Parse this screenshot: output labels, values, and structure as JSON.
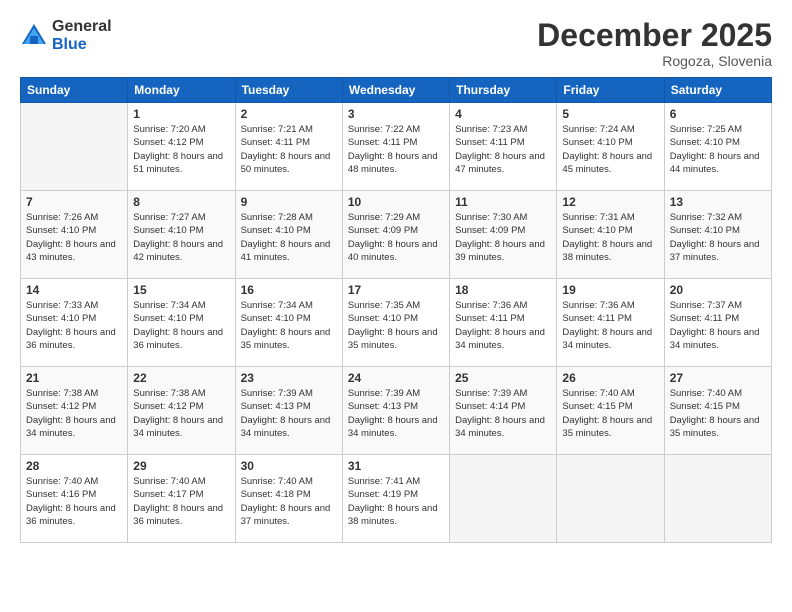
{
  "logo": {
    "general": "General",
    "blue": "Blue"
  },
  "header": {
    "month": "December 2025",
    "location": "Rogoza, Slovenia"
  },
  "weekdays": [
    "Sunday",
    "Monday",
    "Tuesday",
    "Wednesday",
    "Thursday",
    "Friday",
    "Saturday"
  ],
  "weeks": [
    [
      {
        "num": "",
        "empty": true
      },
      {
        "num": "1",
        "sunrise": "7:20 AM",
        "sunset": "4:12 PM",
        "daylight": "8 hours and 51 minutes."
      },
      {
        "num": "2",
        "sunrise": "7:21 AM",
        "sunset": "4:11 PM",
        "daylight": "8 hours and 50 minutes."
      },
      {
        "num": "3",
        "sunrise": "7:22 AM",
        "sunset": "4:11 PM",
        "daylight": "8 hours and 48 minutes."
      },
      {
        "num": "4",
        "sunrise": "7:23 AM",
        "sunset": "4:11 PM",
        "daylight": "8 hours and 47 minutes."
      },
      {
        "num": "5",
        "sunrise": "7:24 AM",
        "sunset": "4:10 PM",
        "daylight": "8 hours and 45 minutes."
      },
      {
        "num": "6",
        "sunrise": "7:25 AM",
        "sunset": "4:10 PM",
        "daylight": "8 hours and 44 minutes."
      }
    ],
    [
      {
        "num": "7",
        "sunrise": "7:26 AM",
        "sunset": "4:10 PM",
        "daylight": "8 hours and 43 minutes."
      },
      {
        "num": "8",
        "sunrise": "7:27 AM",
        "sunset": "4:10 PM",
        "daylight": "8 hours and 42 minutes."
      },
      {
        "num": "9",
        "sunrise": "7:28 AM",
        "sunset": "4:10 PM",
        "daylight": "8 hours and 41 minutes."
      },
      {
        "num": "10",
        "sunrise": "7:29 AM",
        "sunset": "4:09 PM",
        "daylight": "8 hours and 40 minutes."
      },
      {
        "num": "11",
        "sunrise": "7:30 AM",
        "sunset": "4:09 PM",
        "daylight": "8 hours and 39 minutes."
      },
      {
        "num": "12",
        "sunrise": "7:31 AM",
        "sunset": "4:10 PM",
        "daylight": "8 hours and 38 minutes."
      },
      {
        "num": "13",
        "sunrise": "7:32 AM",
        "sunset": "4:10 PM",
        "daylight": "8 hours and 37 minutes."
      }
    ],
    [
      {
        "num": "14",
        "sunrise": "7:33 AM",
        "sunset": "4:10 PM",
        "daylight": "8 hours and 36 minutes."
      },
      {
        "num": "15",
        "sunrise": "7:34 AM",
        "sunset": "4:10 PM",
        "daylight": "8 hours and 36 minutes."
      },
      {
        "num": "16",
        "sunrise": "7:34 AM",
        "sunset": "4:10 PM",
        "daylight": "8 hours and 35 minutes."
      },
      {
        "num": "17",
        "sunrise": "7:35 AM",
        "sunset": "4:10 PM",
        "daylight": "8 hours and 35 minutes."
      },
      {
        "num": "18",
        "sunrise": "7:36 AM",
        "sunset": "4:11 PM",
        "daylight": "8 hours and 34 minutes."
      },
      {
        "num": "19",
        "sunrise": "7:36 AM",
        "sunset": "4:11 PM",
        "daylight": "8 hours and 34 minutes."
      },
      {
        "num": "20",
        "sunrise": "7:37 AM",
        "sunset": "4:11 PM",
        "daylight": "8 hours and 34 minutes."
      }
    ],
    [
      {
        "num": "21",
        "sunrise": "7:38 AM",
        "sunset": "4:12 PM",
        "daylight": "8 hours and 34 minutes."
      },
      {
        "num": "22",
        "sunrise": "7:38 AM",
        "sunset": "4:12 PM",
        "daylight": "8 hours and 34 minutes."
      },
      {
        "num": "23",
        "sunrise": "7:39 AM",
        "sunset": "4:13 PM",
        "daylight": "8 hours and 34 minutes."
      },
      {
        "num": "24",
        "sunrise": "7:39 AM",
        "sunset": "4:13 PM",
        "daylight": "8 hours and 34 minutes."
      },
      {
        "num": "25",
        "sunrise": "7:39 AM",
        "sunset": "4:14 PM",
        "daylight": "8 hours and 34 minutes."
      },
      {
        "num": "26",
        "sunrise": "7:40 AM",
        "sunset": "4:15 PM",
        "daylight": "8 hours and 35 minutes."
      },
      {
        "num": "27",
        "sunrise": "7:40 AM",
        "sunset": "4:15 PM",
        "daylight": "8 hours and 35 minutes."
      }
    ],
    [
      {
        "num": "28",
        "sunrise": "7:40 AM",
        "sunset": "4:16 PM",
        "daylight": "8 hours and 36 minutes."
      },
      {
        "num": "29",
        "sunrise": "7:40 AM",
        "sunset": "4:17 PM",
        "daylight": "8 hours and 36 minutes."
      },
      {
        "num": "30",
        "sunrise": "7:40 AM",
        "sunset": "4:18 PM",
        "daylight": "8 hours and 37 minutes."
      },
      {
        "num": "31",
        "sunrise": "7:41 AM",
        "sunset": "4:19 PM",
        "daylight": "8 hours and 38 minutes."
      },
      {
        "num": "",
        "empty": true
      },
      {
        "num": "",
        "empty": true
      },
      {
        "num": "",
        "empty": true
      }
    ]
  ]
}
